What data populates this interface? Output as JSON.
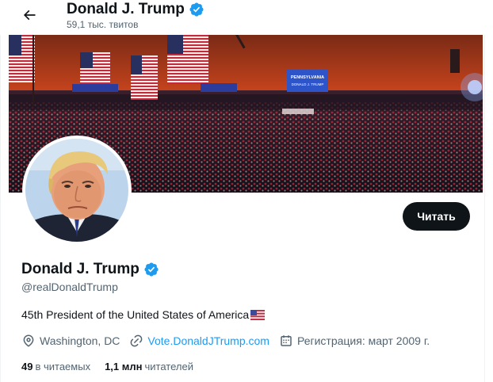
{
  "header": {
    "name": "Donald J. Trump",
    "tweet_count": "59,1 тыс. твитов"
  },
  "profile": {
    "name": "Donald J. Trump",
    "handle": "@realDonaldTrump",
    "bio": "45th President of the United States of America",
    "location": "Washington, DC",
    "website": "Vote.DonaldJTrump.com",
    "joined": "Регистрация: март 2009 г.",
    "following_count": "49",
    "following_label": "в читаемых",
    "followers_count": "1,1 млн",
    "followers_label": "читателей"
  },
  "actions": {
    "follow_label": "Читать"
  },
  "banner": {
    "signs": [
      "PENNSYLVANIA",
      "DONALD J. TRUMP"
    ]
  },
  "colors": {
    "accent": "#1d9bf0",
    "follow_bg": "#0f1419",
    "secondary_text": "#536471",
    "verified": "#1d9bf0"
  },
  "icons": {
    "back": "arrow-left-icon",
    "verified": "verified-badge-icon",
    "location": "location-pin-icon",
    "link": "link-icon",
    "calendar": "calendar-icon",
    "flag": "us-flag-icon"
  }
}
